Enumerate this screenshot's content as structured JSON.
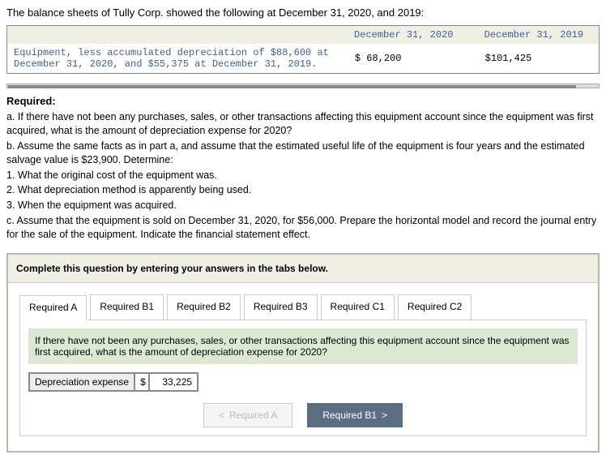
{
  "intro": "The balance sheets of Tully Corp. showed the following at December 31, 2020, and 2019:",
  "table": {
    "col1": "December 31, 2020",
    "col2": "December 31, 2019",
    "row_label": "Equipment, less accumulated depreciation of $88,600 at December 31, 2020, and $55,375 at December 31, 2019.",
    "val1": "$ 68,200",
    "val2": "$101,425"
  },
  "required_head": "Required:",
  "req": {
    "a": "a. If there have not been any purchases, sales, or other transactions affecting this equipment account since the equipment was first acquired, what is the amount of depreciation expense for 2020?",
    "b_lead": "b. Assume the same facts as in part a, and assume that the estimated useful life of the equipment is four years and the estimated salvage value is $23,900. Determine:",
    "b1": "1. What the original cost of the equipment was.",
    "b2": "2. What depreciation method is apparently being used.",
    "b3": "3. When the equipment was acquired.",
    "c": "c. Assume that the equipment is sold on December 31, 2020, for $56,000. Prepare the horizontal model and record the journal entry for the sale of the equipment. Indicate the financial statement effect."
  },
  "hint": "Complete this question by entering your answers in the tabs below.",
  "tabs": {
    "a": "Required A",
    "b1": "Required B1",
    "b2": "Required B2",
    "b3": "Required B3",
    "c1": "Required C1",
    "c2": "Required C2"
  },
  "tab_prompt": "If there have not been any purchases, sales, or other transactions affecting this equipment account since the equipment was first acquired, what is the amount of depreciation expense for 2020?",
  "answer": {
    "label": "Depreciation expense",
    "currency": "$",
    "value": "33,225"
  },
  "nav": {
    "prev": "Required A",
    "next": "Required B1"
  },
  "glyph": {
    "prev": "<",
    "next": ">"
  }
}
